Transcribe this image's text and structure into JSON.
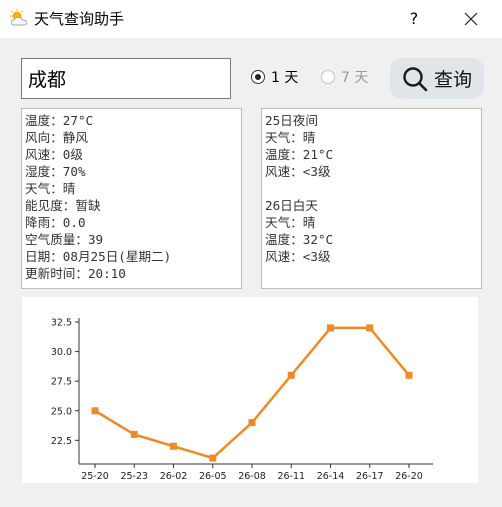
{
  "window": {
    "title": "天气查询助手",
    "help_label": "?"
  },
  "search": {
    "city_value": "成都"
  },
  "options": [
    {
      "label": "1 天",
      "checked": true
    },
    {
      "label": "7 天",
      "checked": false,
      "disabled": true
    }
  ],
  "query_button": {
    "label": "查询"
  },
  "current": {
    "lines": [
      "温度：27°C",
      "风向：静风",
      "风速：0级",
      "湿度：70%",
      "天气：晴",
      "能见度：暂缺",
      "降雨：0.0",
      "空气质量：39",
      "日期：08月25日(星期二)",
      "更新时间：20:10"
    ]
  },
  "forecast": {
    "lines": [
      "25日夜间",
      "天气：晴",
      "温度：21°C",
      "风速：<3级",
      "",
      "26日白天",
      "天气：晴",
      "温度：32°C",
      "风速：<3级"
    ]
  },
  "chart_data": {
    "type": "line",
    "categories": [
      "25-20",
      "25-23",
      "26-02",
      "26-05",
      "26-08",
      "26-11",
      "26-14",
      "26-17",
      "26-20"
    ],
    "series": [
      {
        "values": [
          25,
          23,
          22,
          21,
          24,
          28,
          32,
          32,
          28
        ]
      }
    ],
    "y_ticks": [
      "22.5",
      "25.0",
      "27.5",
      "30.0",
      "32.5"
    ],
    "ylim": [
      20.5,
      32.5
    ],
    "color": "#f08a24",
    "marker": "square",
    "grid": false
  }
}
